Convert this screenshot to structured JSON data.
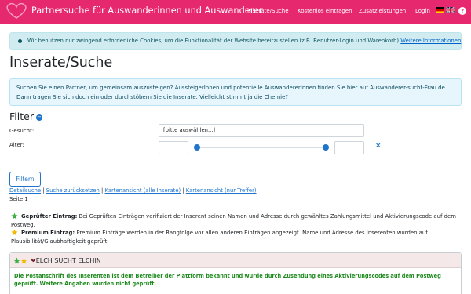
{
  "navbar": {
    "brand": "Partnersuche für Auswanderinnen und Auswanderer",
    "links": [
      "Inserate/Suche",
      "Kostenlos eintragen",
      "Zusatzleistungen",
      "Login"
    ],
    "help": "?",
    "colors": {
      "primary": "#e6286e"
    }
  },
  "cookie_notice": {
    "text": "Wir benutzen nur zwingend erforderliche Cookies, um die Funktionalität der Website bereitzustellen (z.B. Benutzer-Login und Warenkorb)",
    "link": "Weitere Informationen"
  },
  "page": {
    "title": "Inserate/Suche"
  },
  "intro": {
    "text": "Suchen Sie einen Partner, um gemeinsam auszusteigen? AussteigerInnen und potentielle AuswandererInnen finden Sie hier auf Auswanderer-sucht-Frau.de. Dann tragen Sie sich doch ein oder durchstöbern Sie die Inserate. Vielleicht stimmt ja die Chemie?"
  },
  "filter": {
    "title": "Filter",
    "toggle_icon": "−",
    "gesucht_label": "Gesucht:",
    "gesucht_value": "[bitte auswählen...]",
    "alter_label": "Alter:",
    "clear_icon": "×",
    "button": "Filtern"
  },
  "links": {
    "detail": "Detailsuche",
    "reset": "Suche zurücksetzen",
    "map_all": "Kartenansicht (alle Inserate)",
    "map_hits": "Kartenansicht (nur Treffer)",
    "separator": "|"
  },
  "pagination": {
    "text": "Seite 1"
  },
  "legend": {
    "verified_title": "Geprüfter Eintrag:",
    "verified_text": "Bei Geprüften Einträgen verifiziert der Inserent seinen Namen und Adresse durch gewähltes Zahlungsmittel und Aktivierungscode auf dem Postweg.",
    "premium_title": "Premium Eintrag:",
    "premium_text": "Premium Einträge werden in der Rangfolge vor allen anderen Einträgen angezeigt. Name und Adresse des Inserenten wurden auf Plausibilität/Glaubhaftigkeit geprüft."
  },
  "listing": {
    "heart": "❤",
    "title": "ELCH SUCHT ELCHIN",
    "verified_note": "Die Postanschrift des Inserenten ist dem Betreiber der Plattform bekannt und wurde durch Zusendung eines Aktivierungscodes auf dem Postweg geprüft. Weitere Angaben wurden nicht geprüft."
  }
}
